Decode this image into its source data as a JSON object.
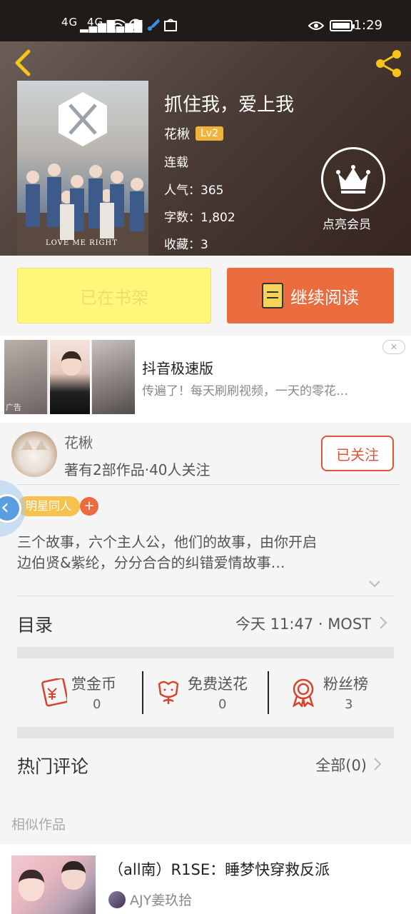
{
  "status_bar": {
    "signal_1": "4G",
    "signal_2": "4G",
    "time": "1:29"
  },
  "book": {
    "title": "抓住我，爱上我",
    "author": "花楸",
    "level": "Lv2",
    "status": "连载",
    "popularity": "人气：365",
    "word_count": "字数：1,802",
    "favorites": "收藏：3",
    "cover_caption": "LOVE ME RIGHT",
    "vip_label": "点亮会员"
  },
  "buttons": {
    "in_shelf": "已在书架",
    "continue_reading": "继续阅读"
  },
  "ad": {
    "title": "抖音极速版",
    "description": "传遍了！每天刷刷视频，一天的零花…",
    "tag": "广告"
  },
  "author_section": {
    "name": "花楸",
    "stats": "著有2部作品·40人关注",
    "follow_label": "已关注",
    "tag": "明星同人",
    "tag_add": "+"
  },
  "description": {
    "line1": "三个故事，六个主人公，他们的故事，由你开启",
    "line2": "边伯贤&紫纶，分分合合的纠错爱情故事…"
  },
  "toc": {
    "label": "目录",
    "latest": "今天 11:47 · MOST"
  },
  "actions": [
    {
      "label": "赏金币",
      "count": "0"
    },
    {
      "label": "免费送花",
      "count": "0"
    },
    {
      "label": "粉丝榜",
      "count": "3"
    }
  ],
  "hot_comments": {
    "label": "热门评论",
    "all": "全部(0)"
  },
  "similar": {
    "header": "相似作品",
    "title": "（all南）R1SE：睡梦快穿救反派",
    "author": "AJY姜玖拾"
  },
  "colors": {
    "accent_orange": "#eb6c3e",
    "shelf_yellow": "#fef77a",
    "follow_red": "#e0543a",
    "level_gold": "#f0b43c"
  }
}
